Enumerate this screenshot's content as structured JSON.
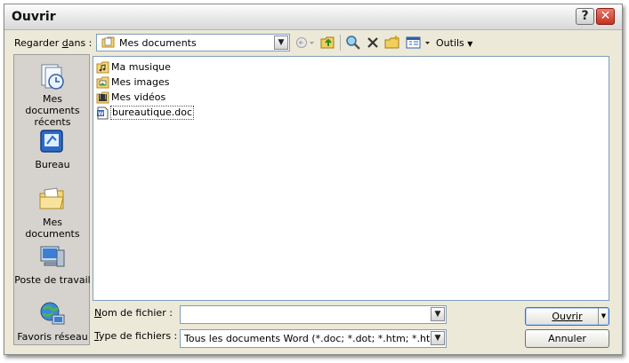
{
  "window": {
    "title": "Ouvrir",
    "help_label": "?",
    "close_label": "✕"
  },
  "look_in": {
    "label": "Regarder dans :",
    "value": "Mes documents"
  },
  "toolbar": {
    "tools_label": "Outils"
  },
  "places": [
    {
      "label": "Mes documents récents",
      "icon": "recent-documents-icon"
    },
    {
      "label": "Bureau",
      "icon": "desktop-icon"
    },
    {
      "label": "Mes documents",
      "icon": "my-documents-icon"
    },
    {
      "label": "Poste de travail",
      "icon": "my-computer-icon"
    },
    {
      "label": "Favoris réseau",
      "icon": "network-places-icon"
    }
  ],
  "files": [
    {
      "name": "Ma musique",
      "icon": "folder-music-icon"
    },
    {
      "name": "Mes images",
      "icon": "folder-pictures-icon"
    },
    {
      "name": "Mes vidéos",
      "icon": "folder-video-icon"
    },
    {
      "name": "bureautique.doc",
      "icon": "word-document-icon",
      "selected": true
    }
  ],
  "file_name": {
    "label": "Nom de fichier :",
    "value": ""
  },
  "file_type": {
    "label": "Type de fichiers :",
    "value": "Tous les documents Word (*.doc; *.dot; *.htm; *.html; *.u"
  },
  "buttons": {
    "open": "Ouvrir",
    "cancel": "Annuler"
  }
}
